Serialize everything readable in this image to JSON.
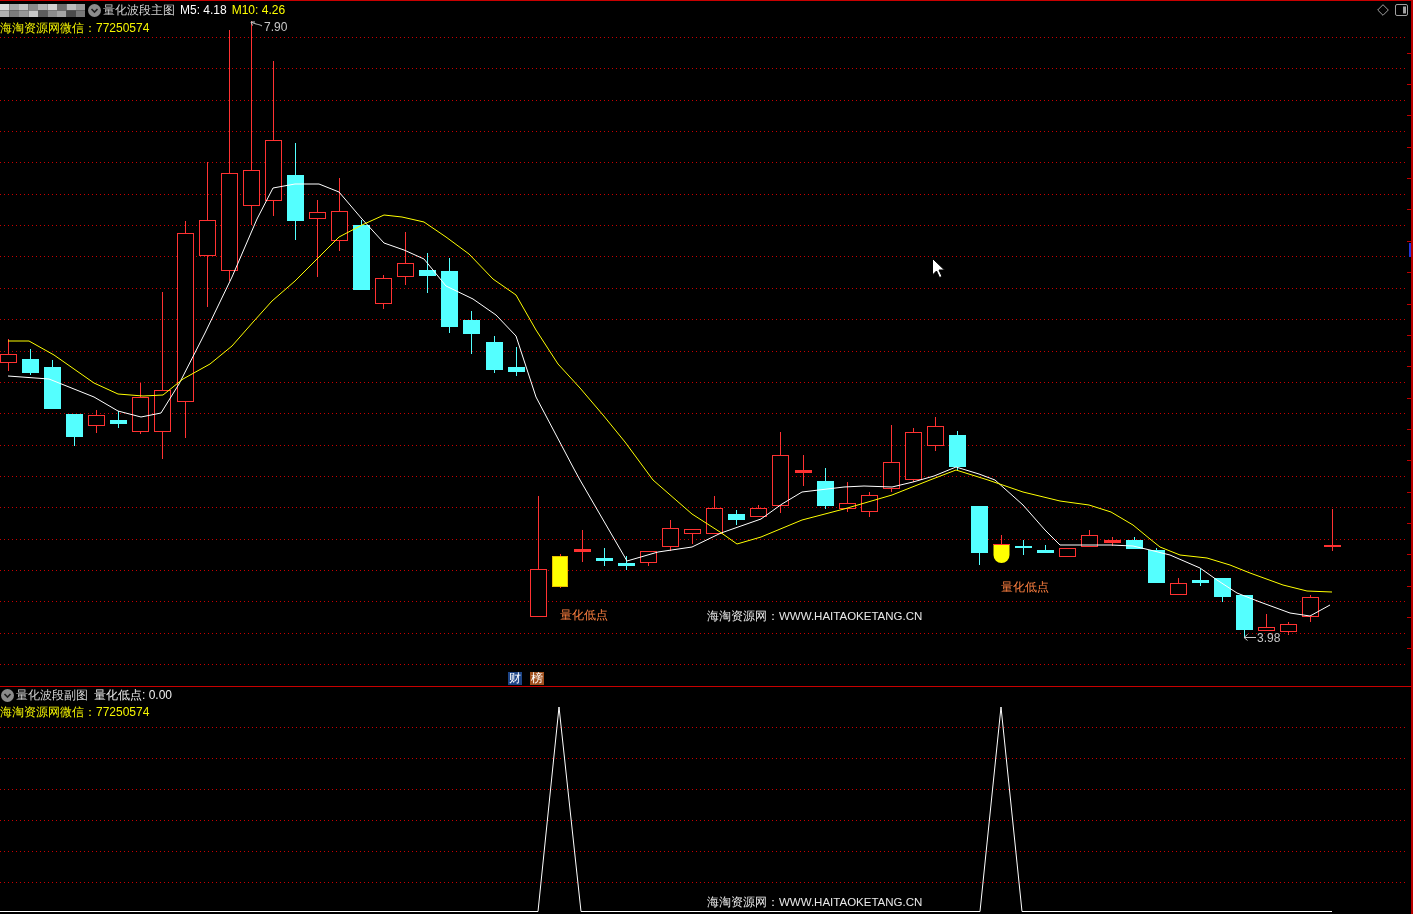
{
  "main_panel": {
    "title": "量化波段主图",
    "indicators": [
      {
        "label": "M5: 4.18",
        "color": "#ffffff"
      },
      {
        "label": "M10: 4.26",
        "color": "#ffff00"
      }
    ],
    "contact": "海淘资源网微信：77250574",
    "high_label": "7.90",
    "signal_labels": [
      "量化低点",
      "量化低点"
    ],
    "site_text": "海淘资源网：WWW.HAITAOKETANG.CN",
    "low_label": "3.98",
    "badges": [
      {
        "label": "财",
        "color": "#1d4486"
      },
      {
        "label": "榜",
        "color": "#a0501e"
      }
    ]
  },
  "sub_panel": {
    "title": "量化波段副图",
    "reading": "量化低点: 0.00",
    "contact": "海淘资源网微信：77250574",
    "site_text": "海淘资源网：WWW.HAITAOKETANG.CN"
  }
}
